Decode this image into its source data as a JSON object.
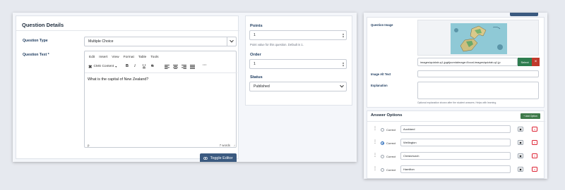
{
  "question_details": {
    "title": "Question Details",
    "question_type_label": "Question Type",
    "question_type_value": "Multiple Choice",
    "question_text_label": "Question Text *",
    "editor": {
      "menu": [
        "Edit",
        "Insert",
        "View",
        "Format",
        "Table",
        "Tools"
      ],
      "cms_content_label": "CMS Content",
      "content": "What is the capital of New Zealand?",
      "status_path": "p",
      "word_count": "7 words"
    },
    "toggle_editor_label": "Toggle Editor"
  },
  "side_panel": {
    "points_label": "Points",
    "points_value": "1",
    "points_help": "Point value for this question. Default is 1.",
    "order_label": "Order",
    "order_value": "1",
    "status_label": "Status",
    "status_value": "Published"
  },
  "image_panel": {
    "question_image_label": "Question Image",
    "image_path": "images/quizlab-q1.jpg#joomlaImage://local-images/quizlab-q1.jp",
    "select_label": "Select",
    "clear_label": "×",
    "alt_text_label": "Image Alt Text",
    "alt_text_value": "",
    "explanation_label": "Explanation",
    "explanation_value": "",
    "explanation_help": "Optional explanation shown after the student answers. Helps with learning."
  },
  "answer_options": {
    "title": "Answer Options",
    "add_option_label": "+ Add Option",
    "correct_label": "Correct",
    "options": [
      {
        "text": "Auckland",
        "correct": false
      },
      {
        "text": "Wellington",
        "correct": true
      },
      {
        "text": "Christchurch",
        "correct": false
      },
      {
        "text": "Hamilton",
        "correct": false
      }
    ]
  },
  "colors": {
    "primary_button": "#3b5a80",
    "select_button": "#2e7d4f",
    "delete_button": "#c0392b",
    "add_option_button": "#3f7a4a"
  }
}
